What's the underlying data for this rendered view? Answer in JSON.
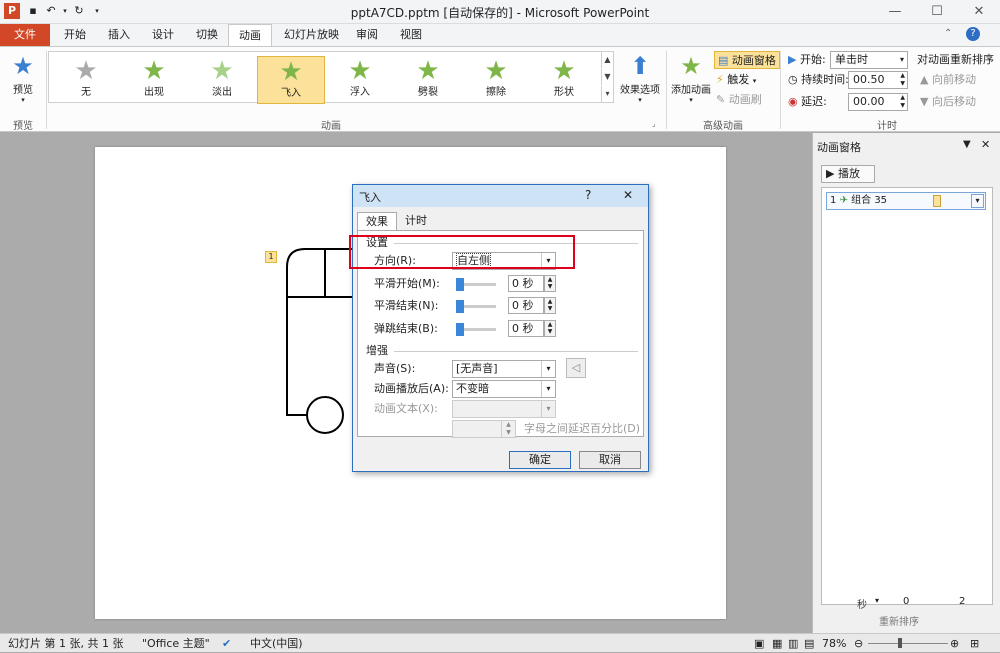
{
  "titlebar": {
    "title": "pptA7CD.pptm [自动保存的] - Microsoft PowerPoint",
    "app_icon": "P",
    "min": "—",
    "max": "☐",
    "close": "✕"
  },
  "tabs": [
    {
      "label": "文件"
    },
    {
      "label": "开始"
    },
    {
      "label": "插入"
    },
    {
      "label": "设计"
    },
    {
      "label": "切换"
    },
    {
      "label": "动画"
    },
    {
      "label": "幻灯片放映"
    },
    {
      "label": "审阅"
    },
    {
      "label": "视图"
    }
  ],
  "ribbon": {
    "preview": {
      "label": "预览",
      "group": "预览"
    },
    "gallery": [
      {
        "label": "无"
      },
      {
        "label": "出现"
      },
      {
        "label": "淡出"
      },
      {
        "label": "飞入"
      },
      {
        "label": "浮入"
      },
      {
        "label": "劈裂"
      },
      {
        "label": "擦除"
      },
      {
        "label": "形状"
      }
    ],
    "animation_group": "动画",
    "effect_options": "效果选项",
    "add_animation": "添加动画",
    "animation_pane_btn": "动画窗格",
    "trigger": "触发",
    "painter": "动画刷",
    "advanced_group": "高级动画",
    "start_label": "开始:",
    "start_value": "单击时",
    "duration_label": "持续时间:",
    "duration_value": "00.50",
    "delay_label": "延迟:",
    "delay_value": "00.00",
    "reorder_title": "对动画重新排序",
    "move_earlier": "向前移动",
    "move_later": "向后移动",
    "timing_group": "计时"
  },
  "slide": {
    "anim_tag": "1"
  },
  "pane": {
    "title": "动画窗格",
    "play": "播放",
    "item_index": "1",
    "item_name": "组合 35",
    "footer_seconds": "秒",
    "footer_num1": "0",
    "footer_num2": "2",
    "footer_reorder": "重新排序"
  },
  "dialog": {
    "title": "飞入",
    "help": "?",
    "close": "✕",
    "tab_effect": "效果",
    "tab_timing": "计时",
    "settings_header": "设置",
    "direction_label": "方向(R):",
    "direction_value": "自左侧",
    "smooth_start_label": "平滑开始(M):",
    "smooth_start_value": "0 秒",
    "smooth_end_label": "平滑结束(N):",
    "smooth_end_value": "0 秒",
    "bounce_end_label": "弹跳结束(B):",
    "bounce_end_value": "0 秒",
    "enhance_header": "增强",
    "sound_label": "声音(S):",
    "sound_value": "[无声音]",
    "after_label": "动画播放后(A):",
    "after_value": "不变暗",
    "text_label": "动画文本(X):",
    "text_value": "",
    "percent_label": "字母之间延迟百分比(D)",
    "ok": "确定",
    "cancel": "取消"
  },
  "status": {
    "slide_info": "幻灯片 第 1 张, 共 1 张",
    "theme": "\"Office 主题\"",
    "language": "中文(中国)",
    "zoom": "78%"
  },
  "colors": {
    "file_tab": "#d24726",
    "selected_gallery": "#fbe19a",
    "highlight_box": "#e0001b",
    "dialog_border": "#2b6fbd"
  }
}
